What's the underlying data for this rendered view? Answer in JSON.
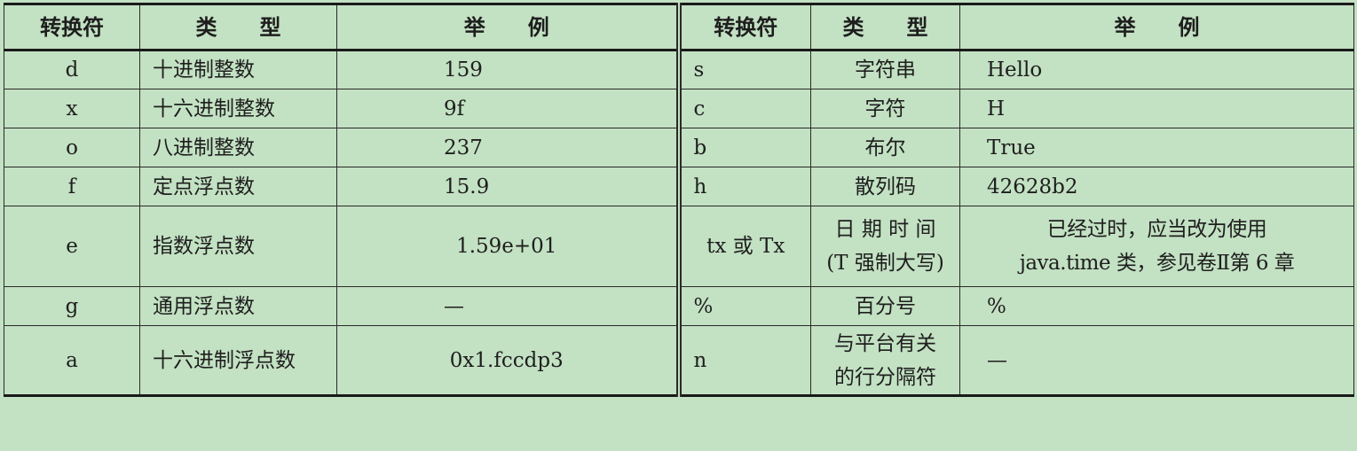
{
  "table": {
    "headers": {
      "left": [
        "转换符",
        "类　　型",
        "举　　例"
      ],
      "right": [
        "转换符",
        "类　　型",
        "举　　例"
      ]
    },
    "rows": [
      {
        "left": [
          "d",
          "十进制整数",
          "159"
        ],
        "right": [
          "s",
          "字符串",
          "Hello"
        ]
      },
      {
        "left": [
          "x",
          "十六进制整数",
          "9f"
        ],
        "right": [
          "c",
          "字符",
          "H"
        ]
      },
      {
        "left": [
          "o",
          "八进制整数",
          "237"
        ],
        "right": [
          "b",
          "布尔",
          "True"
        ]
      },
      {
        "left": [
          "f",
          "定点浮点数",
          "15.9"
        ],
        "right": [
          "h",
          "散列码",
          "42628b2"
        ]
      },
      {
        "left": [
          "e",
          "指数浮点数",
          "1.59e+01"
        ],
        "right": [
          "tx 或 Tx",
          "日 期 时 间\n(T 强制大写)",
          "已经过时，应当改为使用\njava.time 类，参见卷Ⅱ第 6 章"
        ]
      },
      {
        "left": [
          "g",
          "通用浮点数",
          "—"
        ],
        "right": [
          "%",
          "百分号",
          "%"
        ]
      },
      {
        "left": [
          "a",
          "十六进制浮点数",
          "0x1.fccdp3"
        ],
        "right": [
          "n",
          "与平台有关\n的行分隔符",
          "—"
        ]
      }
    ]
  }
}
